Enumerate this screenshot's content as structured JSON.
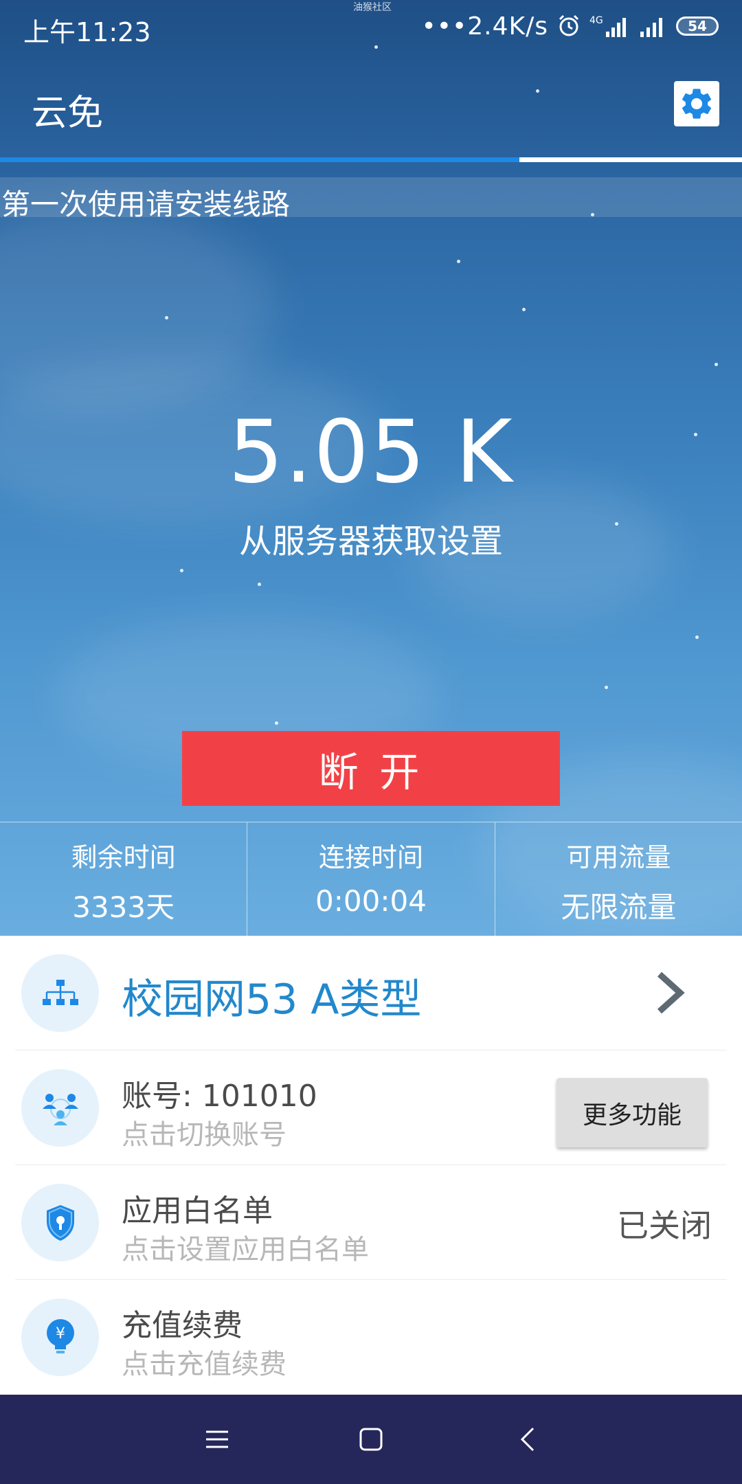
{
  "status_bar": {
    "time": "上午11:23",
    "top_tiny": "油猴社区",
    "speed": "•••2.4K/s",
    "network_label": "4G",
    "battery": "54"
  },
  "app_bar": {
    "title": "云免",
    "progress_fraction": 0.7
  },
  "banner": {
    "text": "第一次使用请安装线路"
  },
  "speed": {
    "value": "5.05 K",
    "caption": "从服务器获取设置"
  },
  "disconnect": {
    "label": "断 开",
    "color": "#f24146"
  },
  "stats": [
    {
      "label": "剩余时间",
      "value": "3333天"
    },
    {
      "label": "连接时间",
      "value": "0:00:04"
    },
    {
      "label": "可用流量",
      "value": "无限流量"
    }
  ],
  "rows": {
    "line": {
      "title": "校园网53 A类型",
      "icon": "network-tree-icon"
    },
    "account": {
      "title": "账号: 101010",
      "subtitle": "点击切换账号",
      "button": "更多功能",
      "icon": "users-icon"
    },
    "whitelist": {
      "title": "应用白名单",
      "subtitle": "点击设置应用白名单",
      "status": "已关闭",
      "icon": "shield-key-icon"
    },
    "recharge": {
      "title": "充值续费",
      "subtitle": "点击充值续费",
      "icon": "yen-bulb-icon"
    }
  },
  "colors": {
    "accent": "#2288cc",
    "icon_blue": "#1e88e5",
    "nav_bg": "#25265a"
  },
  "nav": {
    "menu_icon": "menu-icon",
    "home_icon": "home-icon",
    "back_icon": "back-icon"
  }
}
